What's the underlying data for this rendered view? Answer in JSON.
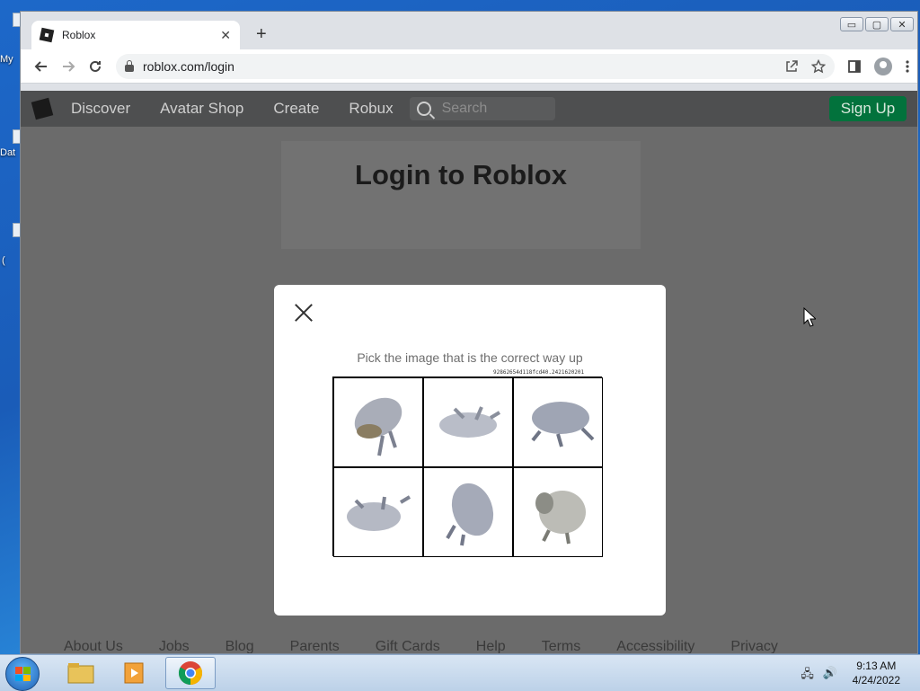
{
  "browser": {
    "tab_title": "Roblox",
    "tab_close": "✕",
    "new_tab": "+",
    "url": "roblox.com/login",
    "window_controls": [
      "▭",
      "▢",
      "✕"
    ]
  },
  "desktop": {
    "icon_labels": [
      "My",
      "Dat",
      "("
    ]
  },
  "roblox": {
    "nav": [
      "Discover",
      "Avatar Shop",
      "Create",
      "Robux"
    ],
    "search_placeholder": "Search",
    "signup_label": "Sign Up",
    "login_title": "Login to Roblox",
    "footer_links": [
      "About Us",
      "Jobs",
      "Blog",
      "Parents",
      "Gift Cards",
      "Help",
      "Terms",
      "Accessibility",
      "Privacy"
    ]
  },
  "captcha": {
    "prompt": "Pick the image that is the correct way up",
    "token": "92862654d118fcd40.2421620201",
    "tiles": [
      {
        "label": "toad-tile-1"
      },
      {
        "label": "toad-tile-2"
      },
      {
        "label": "toad-tile-3"
      },
      {
        "label": "toad-tile-4"
      },
      {
        "label": "toad-tile-5"
      },
      {
        "label": "toad-tile-6"
      }
    ]
  },
  "taskbar": {
    "time": "9:13 AM",
    "date": "4/24/2022"
  },
  "colors": {
    "signup": "#02723c",
    "overlay": "#6b6b6b"
  }
}
